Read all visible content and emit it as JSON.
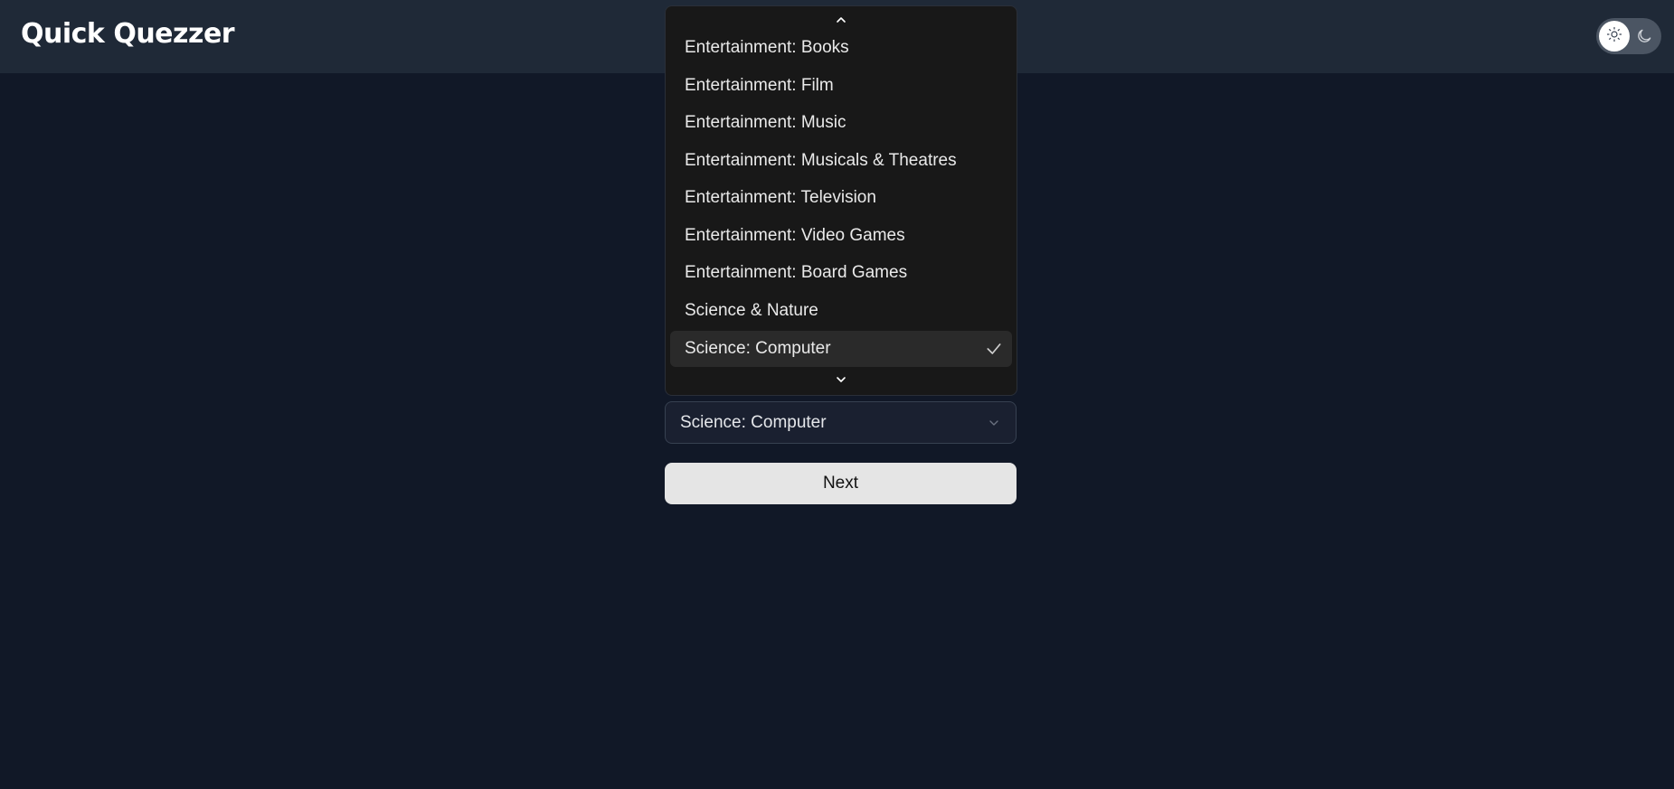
{
  "header": {
    "title": "Quick Quezzer",
    "theme_toggle": {
      "state": "light",
      "icons": [
        "sun-icon",
        "moon-icon"
      ]
    }
  },
  "category_dropdown": {
    "scroll_up_icon": "chevron-up-icon",
    "scroll_down_icon": "chevron-down-icon",
    "options": [
      {
        "label": "Entertainment: Books",
        "selected": false
      },
      {
        "label": "Entertainment: Film",
        "selected": false
      },
      {
        "label": "Entertainment: Music",
        "selected": false
      },
      {
        "label": "Entertainment: Musicals & Theatres",
        "selected": false
      },
      {
        "label": "Entertainment: Television",
        "selected": false
      },
      {
        "label": "Entertainment: Video Games",
        "selected": false
      },
      {
        "label": "Entertainment: Board Games",
        "selected": false
      },
      {
        "label": "Science & Nature",
        "selected": false
      },
      {
        "label": "Science: Computer",
        "selected": true
      }
    ],
    "selected_value": "Science: Computer"
  },
  "actions": {
    "next_label": "Next"
  },
  "colors": {
    "page_background": "#111827",
    "header_background": "#1f2937",
    "dropdown_background": "#181818",
    "selected_option_background": "#2a2a2a",
    "button_background": "#e5e5e5"
  }
}
